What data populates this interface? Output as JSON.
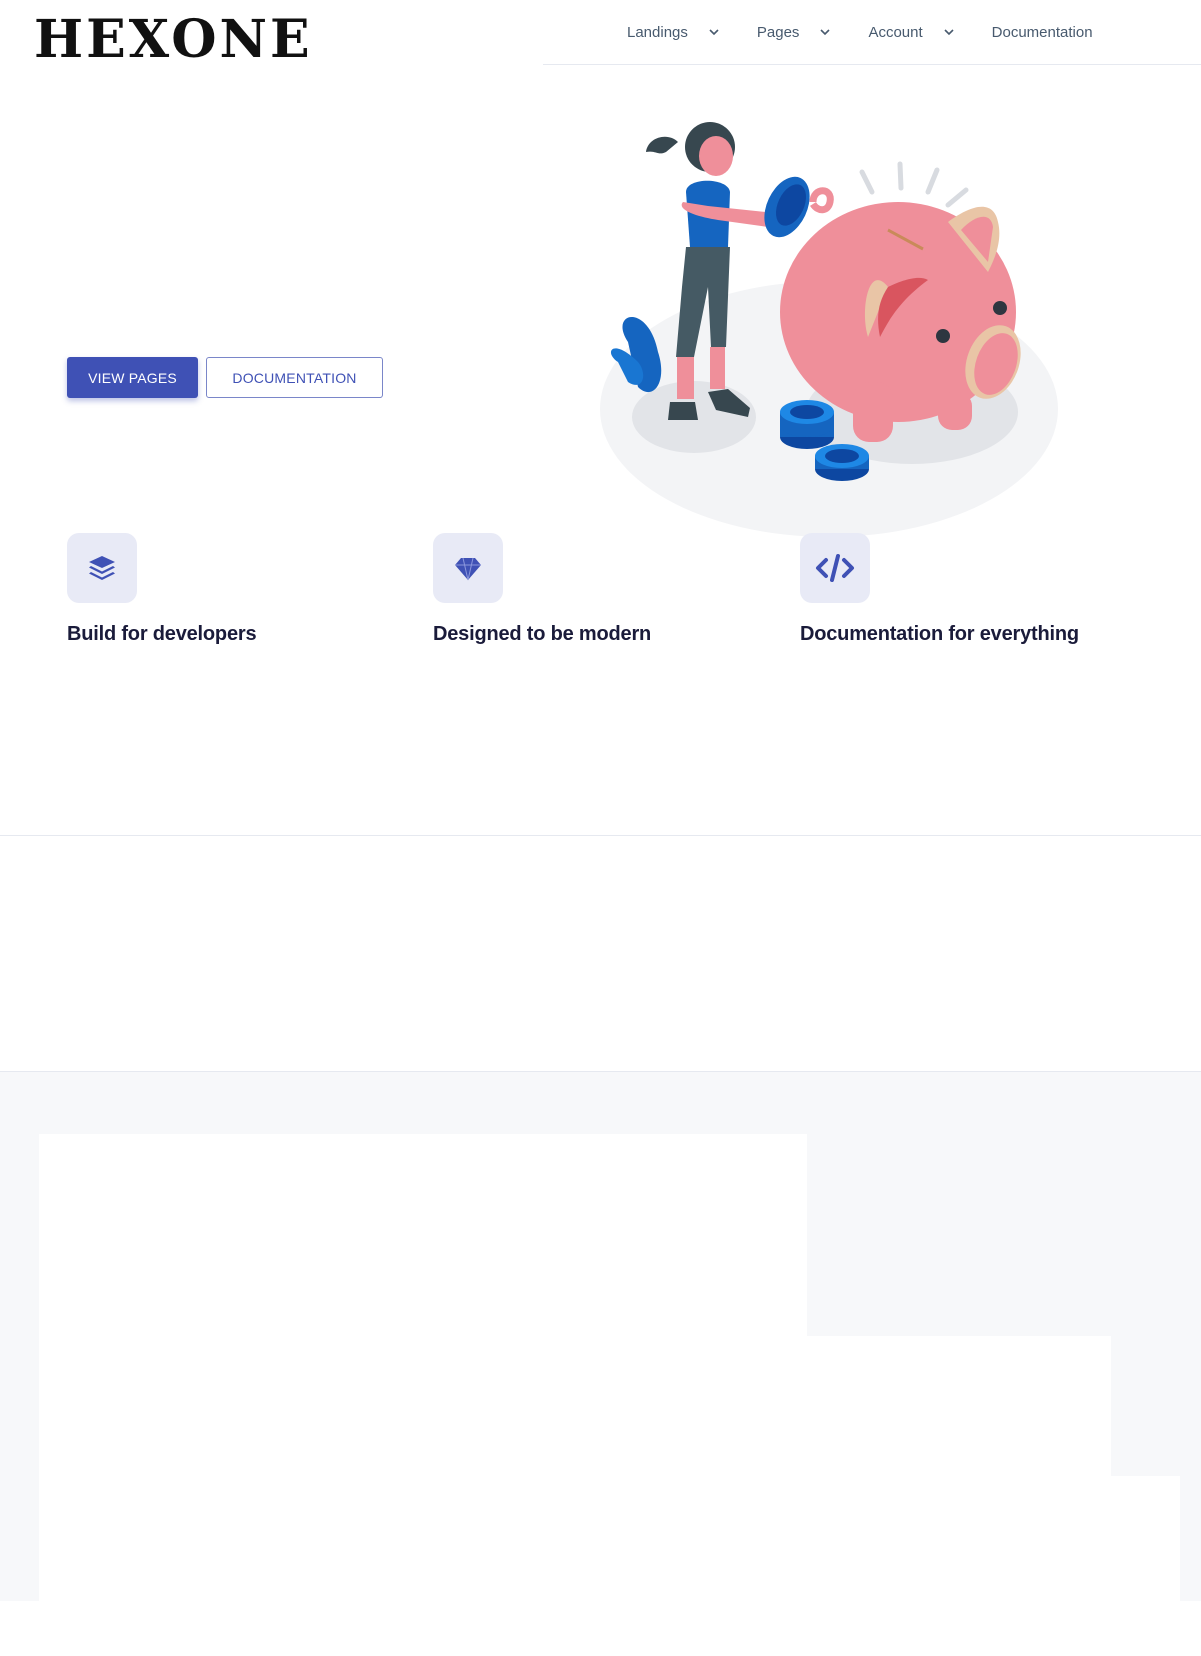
{
  "header": {
    "logo": "HEXONE",
    "nav": [
      {
        "label": "Landings",
        "has_dropdown": true
      },
      {
        "label": "Pages",
        "has_dropdown": true
      },
      {
        "label": "Account",
        "has_dropdown": true
      },
      {
        "label": "Documentation",
        "has_dropdown": false
      }
    ]
  },
  "hero": {
    "primary_button": "VIEW PAGES",
    "secondary_button": "DOCUMENTATION",
    "illustration": "woman-saving-coins-in-piggy-bank"
  },
  "features": [
    {
      "icon": "layers-icon",
      "title": "Build for developers"
    },
    {
      "icon": "diamond-icon",
      "title": "Designed to be modern"
    },
    {
      "icon": "code-icon",
      "title": "Documentation for everything"
    }
  ],
  "colors": {
    "primary": "#3f51b5",
    "icon_bg": "#e8eaf6",
    "nav_text": "#485a6e",
    "heading": "#1a1b3a",
    "section_bg": "#f7f8fa"
  }
}
